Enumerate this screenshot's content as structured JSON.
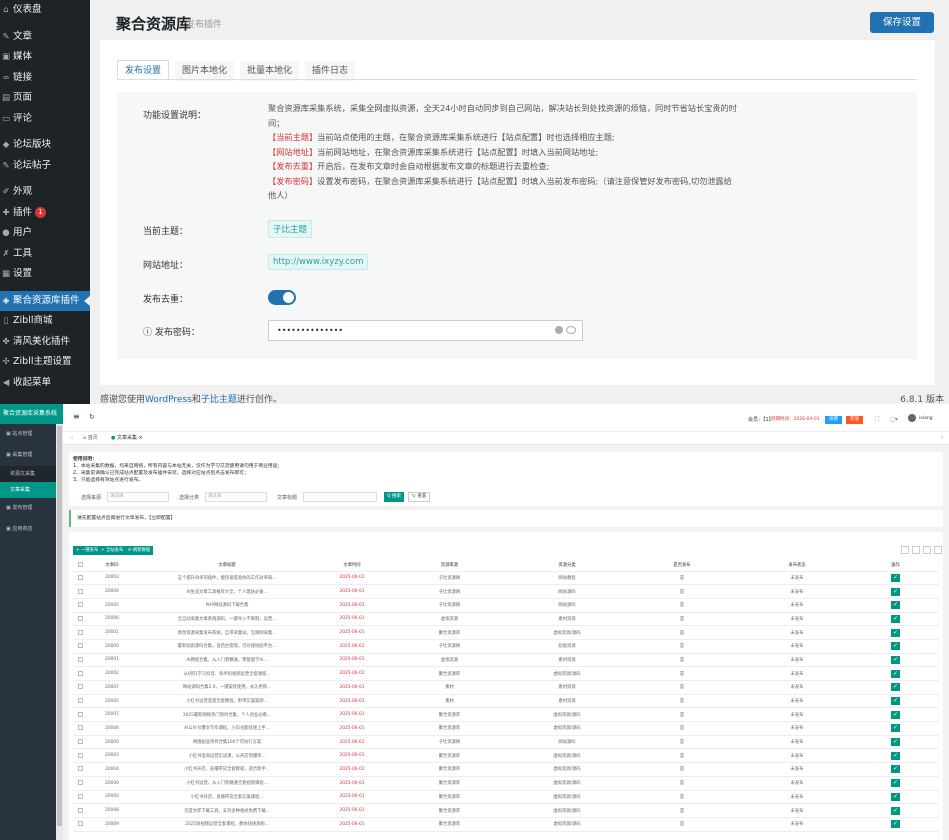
{
  "wp_sidebar": [
    {
      "icon": "dashboard-icon",
      "glyph": "⌂",
      "label": "仪表盘",
      "sep": false
    },
    {
      "icon": "pin-icon",
      "glyph": "✎",
      "label": "文章",
      "sep": true
    },
    {
      "icon": "media-icon",
      "glyph": "▣",
      "label": "媒体",
      "sep": false
    },
    {
      "icon": "link-icon",
      "glyph": "∞",
      "label": "链接",
      "sep": false
    },
    {
      "icon": "page-icon",
      "glyph": "▤",
      "label": "页面",
      "sep": false
    },
    {
      "icon": "comment-icon",
      "glyph": "▭",
      "label": "评论",
      "sep": false
    },
    {
      "icon": "forum-icon",
      "glyph": "◆",
      "label": "论坛版块",
      "sep": true
    },
    {
      "icon": "forum-post-icon",
      "glyph": "✎",
      "label": "论坛帖子",
      "sep": false
    },
    {
      "icon": "appearance-icon",
      "glyph": "✐",
      "label": "外观",
      "sep": true
    },
    {
      "icon": "plugin-icon",
      "glyph": "✚",
      "label": "插件",
      "badge": "1",
      "sep": false
    },
    {
      "icon": "user-icon",
      "glyph": "●",
      "label": "用户",
      "sep": false
    },
    {
      "icon": "tool-icon",
      "glyph": "✗",
      "label": "工具",
      "sep": false
    },
    {
      "icon": "settings-icon",
      "glyph": "▦",
      "label": "设置",
      "sep": false
    },
    {
      "icon": "plugin-shield-icon",
      "glyph": "◈",
      "label": "聚合资源库插件",
      "active": true,
      "sep": true
    },
    {
      "icon": "shop-icon",
      "glyph": "▯",
      "label": "Zibll商城",
      "sep": false
    },
    {
      "icon": "beauty-icon",
      "glyph": "✤",
      "label": "清风美化插件",
      "sep": false
    },
    {
      "icon": "theme-icon",
      "glyph": "✣",
      "label": "Zibll主题设置",
      "sep": false
    },
    {
      "icon": "collapse-icon",
      "glyph": "◀",
      "label": "收起菜单",
      "sep": false
    }
  ],
  "header": {
    "title": "聚合资源库",
    "subtitle": "发布插件",
    "save": "保存设置"
  },
  "tabs": [
    "发布设置",
    "图片本地化",
    "批量本地化",
    "插件日志"
  ],
  "form": {
    "desc_label": "功能设置说明：",
    "desc_intro": "聚合资源库采集系统，采集全网虚拟资源，全天24小时自动同步到自己网站，解决站长到处找资源的烦恼，同时节省站长宝贵的时间；",
    "desc_lines": [
      {
        "tag": "【当前主题】",
        "text": "当前站点使用的主题，在聚合资源库采集系统进行【站点配置】时也选择相应主题;"
      },
      {
        "tag": "【网站地址】",
        "text": "当前网站地址，在聚合资源库采集系统进行【站点配置】时填入当前网站地址;"
      },
      {
        "tag": "【发布去重】",
        "text": "开启后，在发布文章时会自动根据发布文章的标题进行去重检查;"
      },
      {
        "tag": "【发布密码】",
        "text": "设置发布密码，在聚合资源库采集系统进行【站点配置】时填入当前发布密码;（请注意保管好发布密码,切勿泄露给他人）"
      }
    ],
    "theme_label": "当前主题：",
    "theme_value": "子比主题",
    "url_label": "网站地址：",
    "url_value": "http://www.ixyzy.com",
    "dedup_label": "发布去重：",
    "pwd_label": "发布密码：",
    "pwd_value": "••••••••••••••"
  },
  "footer": {
    "pre": "感谢您使用",
    "wp": "WordPress",
    "mid": "和",
    "zibi": "子比主题",
    "post": "进行创作。",
    "version": "6.8.1 版本"
  },
  "cms": {
    "title": "聚合资源库采集系统",
    "menu": [
      {
        "label": "▣ 站点管理",
        "sub": false
      },
      {
        "label": "▣ 采集管理",
        "sub": false
      },
      {
        "label": "资源文采集",
        "sub": true,
        "on": false
      },
      {
        "label": "文章采集",
        "sub": true,
        "on": true
      },
      {
        "label": "▣ 发布管理",
        "sub": false
      },
      {
        "label": "▣ 应用商店",
        "sub": false
      }
    ],
    "top": {
      "account": "会员：【1】",
      "expire": "到期时间：2026-04-01",
      "b1": "续费",
      "b2": "充值",
      "user": "ixiang"
    },
    "tabs": [
      "首页",
      "文章采集 ×"
    ],
    "note_title": "使用说明：",
    "notes": [
      "1、本站采集的数据，均来自网络，所有内容与本站无关，仅作为学习交流使用请勿用于商业用途；",
      "2、采集前请确认已完成站点配置及发布插件安装，选择对应站点后点击发布即可；",
      "3、只能选择有效站点进行发布。"
    ],
    "search": {
      "source_label": "选择来源",
      "source_ph": "请选择",
      "cat_label": "选择分类",
      "cat_ph": "请选择",
      "title_label": "文章标题",
      "btn": "Q 搜索",
      "reset": "↻ 重置"
    },
    "info": "请先配置站点后再进行文章发布，【立即配置】",
    "actions": [
      "+ 一键发布",
      "+ 全站发布",
      "⟳ 刷新数据"
    ],
    "columns": [
      "",
      "文章ID",
      "文章标题",
      "文章时间",
      "资源来源",
      "资源分类",
      "是否发布",
      "发布状态",
      "操作"
    ],
    "rows": [
      [
        "20003",
        "五个提升效率的插件，能快速提高你的工作效率和...",
        "2025-06-01",
        "子比资源网",
        "网站教程",
        "是",
        "未发布"
      ],
      [
        "20004",
        "AI生成文章工具推荐大全，个人建站必备...",
        "2025-06-01",
        "子比资源网",
        "网站源码",
        "是",
        "未发布"
      ],
      [
        "20005",
        "PHP网站源码下载合集",
        "2025-06-01",
        "子比资源网",
        "网站源码",
        "是",
        "未发布"
      ],
      [
        "20006",
        "全自动采集文章系统源码，一键导入不限制，运营...",
        "2025-06-01",
        "虚拟资源",
        "素材资源",
        "是",
        "未发布"
      ],
      [
        "20001",
        "原创资源采集发布系统，自带采集站，无限制采集...",
        "2025-06-01",
        "聚合资源库",
        "虚拟资源/源码",
        "是",
        "未发布"
      ],
      [
        "20000",
        "最新短剧源码合集，含后台管理，可对接短剧平台...",
        "2025-06-01",
        "子比资源网",
        "短剧资源",
        "是",
        "未发布"
      ],
      [
        "20001",
        "AI教程合集，从入门到精通，零基础学AI...",
        "2025-06-01",
        "虚拟资源",
        "素材资源",
        "是",
        "未发布"
      ],
      [
        "20002",
        "从0到1学习抖音、快手短视频运营全套课程...",
        "2025-06-01",
        "聚合资源库",
        "虚拟资源/源码",
        "是",
        "未发布"
      ],
      [
        "20007",
        "网站源码合集2.0，一键安装使用，永久更新...",
        "2025-06-01",
        "素材",
        "素材资源",
        "是",
        "未发布"
      ],
      [
        "20005",
        "小红书运营变现全套教程，附带实操案例...",
        "2025-06-01",
        "素材",
        "素材资源",
        "是",
        "未发布"
      ],
      [
        "20007",
        "2025最新网络热门项目合集，个人创业必看...",
        "2025-06-01",
        "聚合资源库",
        "虚拟资源/源码",
        "是",
        "未发布"
      ],
      [
        "20006",
        "AI公众号爆文写作课程，小白也能快速上手...",
        "2025-06-01",
        "聚合资源库",
        "虚拟资源/源码",
        "是",
        "未发布"
      ],
      [
        "20000",
        "网络副业项目合集100个可执行方案",
        "2025-06-01",
        "子比资源网",
        "网站源码",
        "是",
        "未发布"
      ],
      [
        "20003",
        "小红书电商运营实战课，从开店到爆单...",
        "2025-06-01",
        "聚合资源库",
        "虚拟资源/源码",
        "是",
        "未发布"
      ],
      [
        "20004",
        "小红书开店，直播带货全套教程，适合新手...",
        "2025-06-01",
        "聚合资源库",
        "虚拟资源/源码",
        "是",
        "未发布"
      ],
      [
        "20000",
        "小红书运营，从入门到精通全套视频课程...",
        "2025-06-01",
        "聚合资源库",
        "虚拟资源/源码",
        "是",
        "未发布"
      ],
      [
        "20000",
        "小红书开店，直播带货全套实操课程...",
        "2025-06-01",
        "聚合资源库",
        "虚拟资源/源码",
        "是",
        "未发布"
      ],
      [
        "20008",
        "百度文库下载工具，支持多种格式免费下载...",
        "2025-06-01",
        "聚合资源库",
        "虚拟资源/源码",
        "是",
        "未发布"
      ],
      [
        "20009",
        "2025短视频运营全套课程，教你快速涨粉...",
        "2025-06-01",
        "聚合资源库",
        "虚拟资源/源码",
        "是",
        "未发布"
      ]
    ]
  }
}
